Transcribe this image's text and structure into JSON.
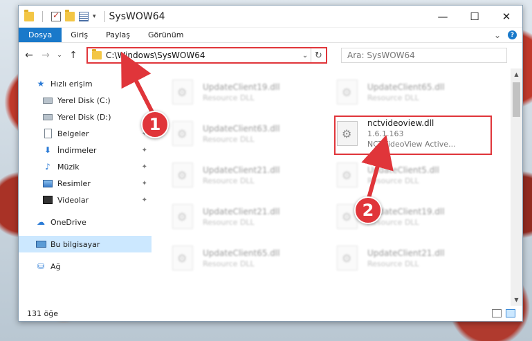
{
  "window": {
    "title": "SysWOW64",
    "controls": {
      "minimize": "—",
      "maximize": "☐",
      "close": "✕"
    }
  },
  "ribbon": {
    "tabs": [
      "Dosya",
      "Giriş",
      "Paylaş",
      "Görünüm"
    ],
    "expand": "⌄",
    "help": "?"
  },
  "nav": {
    "back": "←",
    "forward": "→",
    "recent": "⌄",
    "up": "↑",
    "address": "C:\\Windows\\SysWOW64",
    "address_dropdown": "⌄",
    "refresh": "↻",
    "search_placeholder": "Ara: SysWOW64"
  },
  "sidebar": {
    "quick_access": "Hızlı erişim",
    "items": [
      {
        "label": "Yerel Disk (C:)",
        "icon": "drive-icon",
        "pinned": false
      },
      {
        "label": "Yerel Disk (D:)",
        "icon": "drive-icon",
        "pinned": false
      },
      {
        "label": "Belgeler",
        "icon": "document-icon",
        "pinned": true
      },
      {
        "label": "İndirmeler",
        "icon": "download-icon",
        "pinned": true
      },
      {
        "label": "Müzik",
        "icon": "music-icon",
        "pinned": true
      },
      {
        "label": "Resimler",
        "icon": "pictures-icon",
        "pinned": true
      },
      {
        "label": "Videolar",
        "icon": "video-icon",
        "pinned": true
      }
    ],
    "onedrive": "OneDrive",
    "this_pc": "Bu bilgisayar",
    "network": "Ağ",
    "pin_glyph": "📌"
  },
  "files": [
    {
      "name": "UpdateClient19.dll",
      "desc": "Resource DLL"
    },
    {
      "name": "UpdateClient65.dll",
      "desc": "Resource DLL"
    },
    {
      "name": "UpdateClient63.dll",
      "desc": "Resource DLL"
    },
    {
      "name": "nctvideoview.dll",
      "version": "1.6.1.163",
      "desc": "NCTVideoView Active..."
    },
    {
      "name": "UpdateClient21.dll",
      "desc": "Resource DLL"
    },
    {
      "name": "UpdateClient5.dll",
      "desc": "Resource DLL"
    },
    {
      "name": "UpdateClient21.dll",
      "desc": "Resource DLL"
    },
    {
      "name": "UpdateClient19.dll",
      "desc": "Resource DLL"
    },
    {
      "name": "UpdateClient65.dll",
      "desc": "Resource DLL"
    },
    {
      "name": "UpdateClient21.dll",
      "desc": "Resource DLL"
    }
  ],
  "status": {
    "count": "131 öğe"
  },
  "annotations": {
    "step1": "1",
    "step2": "2",
    "accent": "#e0353a"
  }
}
